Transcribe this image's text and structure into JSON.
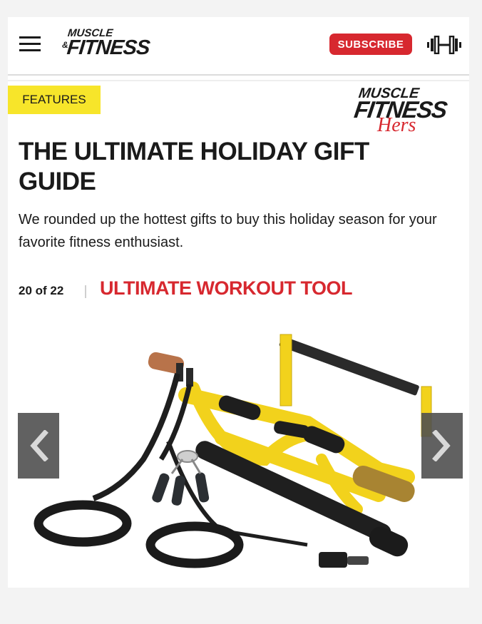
{
  "header": {
    "logo_line1": "MUSCLE",
    "logo_amp": "&",
    "logo_line2": "FITNESS",
    "subscribe_label": "SUBSCRIBE"
  },
  "section_badge": "FEATURES",
  "hers_logo": {
    "line1": "MUSCLE",
    "line2": "FITNESS",
    "line3": "Hers"
  },
  "article": {
    "title": "THE ULTIMATE HOLIDAY GIFT GUIDE",
    "description": "We rounded up the hottest gifts to buy this holiday season for your favorite fitness enthusiast."
  },
  "gallery": {
    "counter": "20 of 22",
    "slide_title": "ULTIMATE WORKOUT TOOL"
  },
  "colors": {
    "accent_red": "#d7282f",
    "badge_yellow": "#f7e52a",
    "product_yellow": "#f2d21c"
  },
  "icons": {
    "menu": "hamburger-menu-icon",
    "dumbbell": "dumbbell-icon",
    "prev": "chevron-left-icon",
    "next": "chevron-right-icon"
  }
}
